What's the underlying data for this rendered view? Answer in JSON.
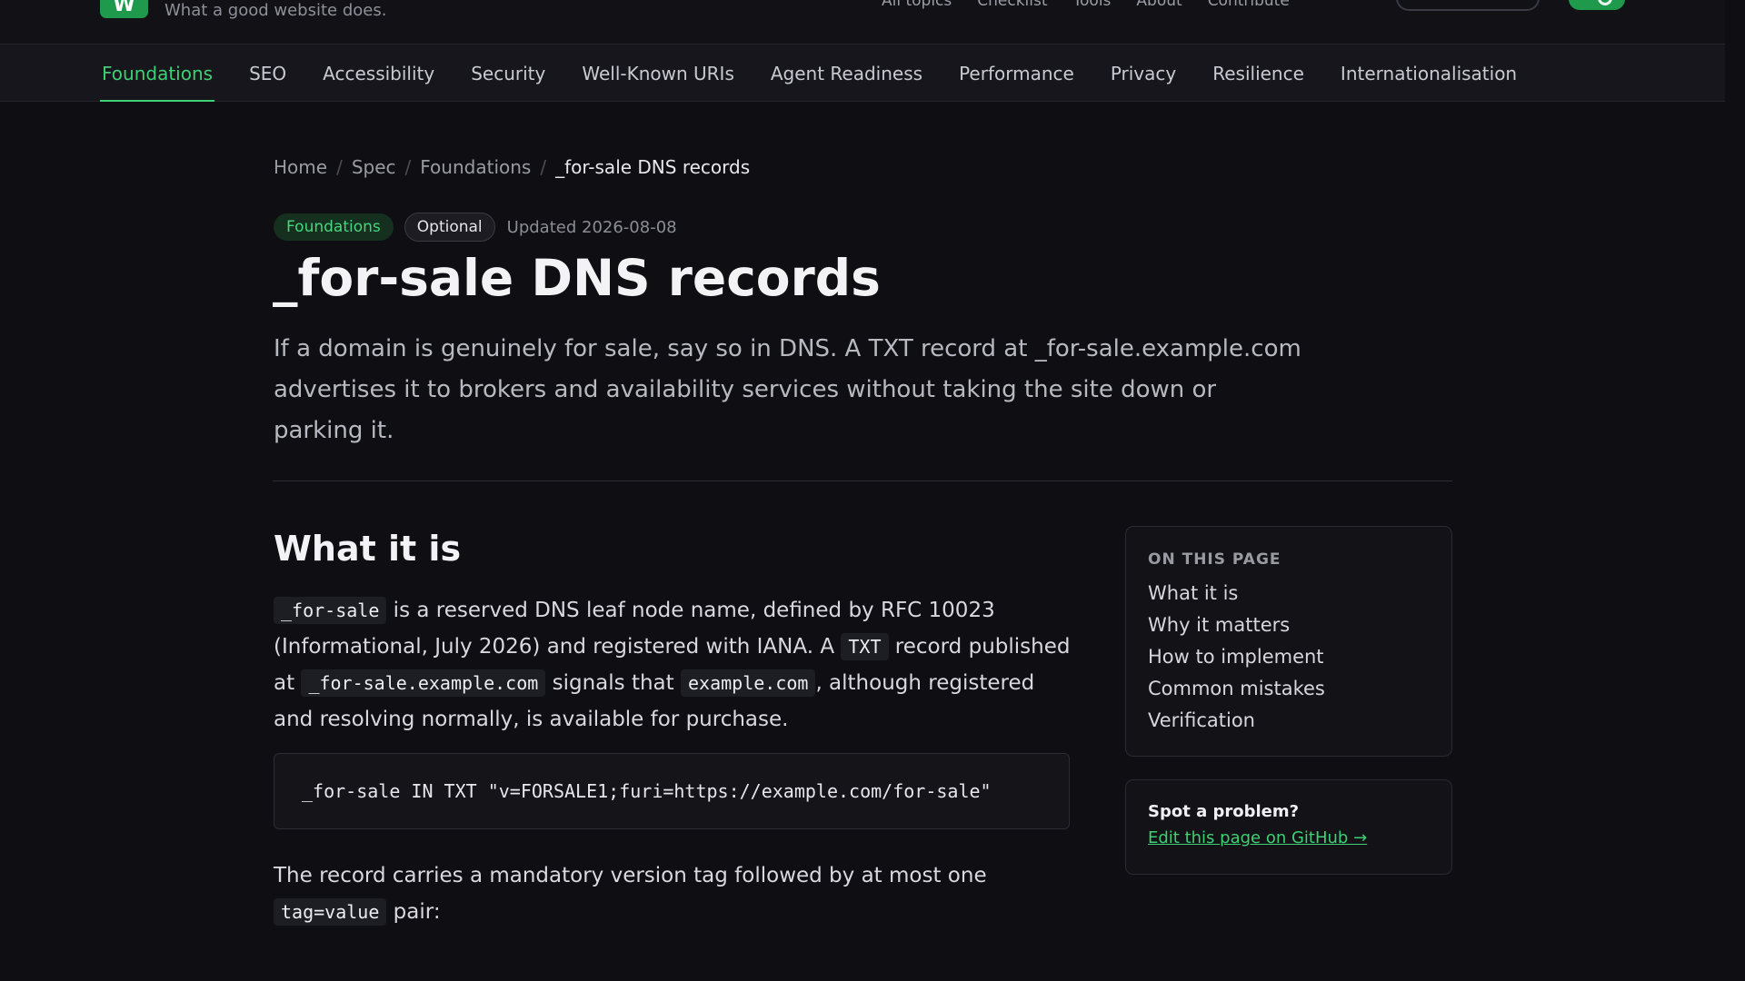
{
  "header": {
    "logo_letter": "W",
    "tagline": "What a good website does.",
    "links": [
      "All topics",
      "Checklist",
      "Tools",
      "About",
      "Contribute"
    ],
    "brand_color": "#1f9a4c"
  },
  "category_nav": {
    "items": [
      {
        "label": "Foundations",
        "active": true
      },
      {
        "label": "SEO",
        "active": false
      },
      {
        "label": "Accessibility",
        "active": false
      },
      {
        "label": "Security",
        "active": false
      },
      {
        "label": "Well-Known URIs",
        "active": false
      },
      {
        "label": "Agent Readiness",
        "active": false
      },
      {
        "label": "Performance",
        "active": false
      },
      {
        "label": "Privacy",
        "active": false
      },
      {
        "label": "Resilience",
        "active": false
      },
      {
        "label": "Internationalisation",
        "active": false
      }
    ],
    "accent_color": "#3fcf74"
  },
  "breadcrumb": {
    "items": [
      "Home",
      "Spec",
      "Foundations"
    ],
    "current": "_for-sale DNS records",
    "separator": "/"
  },
  "meta": {
    "category_badge": "Foundations",
    "level_badge": "Optional",
    "updated": "Updated 2026-08-08"
  },
  "page": {
    "title": "_for-sale DNS records",
    "lede": "If a domain is genuinely for sale, say so in DNS. A TXT record at _for-sale.example.com advertises it to brokers and availability services without taking the site down or parking it."
  },
  "section": {
    "heading": "What it is",
    "p1": {
      "code1": "_for-sale",
      "t1": " is a reserved DNS leaf node name, defined by RFC 10023 (Informational, July 2026) and registered with IANA. A ",
      "code2": "TXT",
      "t2": " record published at ",
      "code3": "_for-sale.example.com",
      "t3": " signals that ",
      "code4": "example.com",
      "t4": ", although registered and resolving normally, is available for purchase."
    },
    "code_block": "_for-sale IN TXT \"v=FORSALE1;furi=https://example.com/for-sale\"",
    "p2": {
      "t1": "The record carries a mandatory version tag followed by at most one ",
      "code1": "tag=value",
      "t2": " pair:"
    }
  },
  "toc": {
    "heading": "ON THIS PAGE",
    "items": [
      "What it is",
      "Why it matters",
      "How to implement",
      "Common mistakes",
      "Verification"
    ]
  },
  "problem_box": {
    "title": "Spot a problem?",
    "link": "Edit this page on GitHub →"
  }
}
